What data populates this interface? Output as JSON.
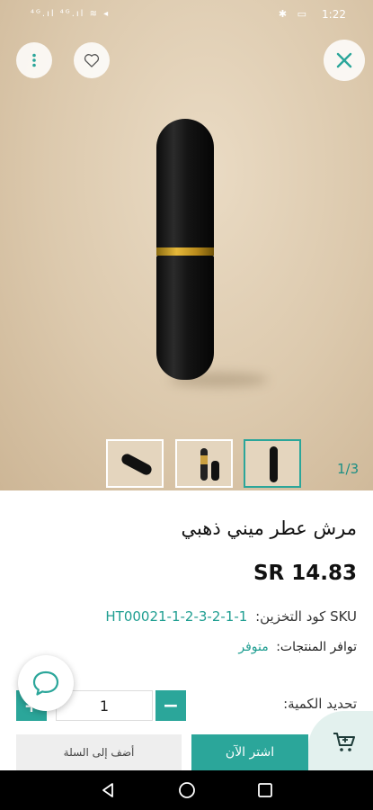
{
  "status_bar": {
    "left_icons": "⁴ᴳ.ıl ⁴ᴳ.ıl ≋ ◂",
    "right_icons": "✱ ▭",
    "time": "1:22"
  },
  "product": {
    "title": "مرش عطر ميني ذهبي",
    "price": "SR 14.83",
    "sku_label": "SKU كود التخزين:",
    "sku_value": "HT00021-1-2-3-2-1-1",
    "availability_label": "توافر المنتجات:",
    "availability_value": "متوفر",
    "image_counter": "1/3"
  },
  "quantity": {
    "label": "تحديد الكمية:",
    "value": "1"
  },
  "actions": {
    "buy_now": "اشتر الآن",
    "add_to_cart": "أضف إلى السلة"
  },
  "colors": {
    "accent": "#2ba69a",
    "hero_bg": "#dcc9ad"
  },
  "icons": [
    "more-vertical-icon",
    "heart-icon",
    "close-icon",
    "chat-icon",
    "cart-icon",
    "back-icon",
    "home-icon",
    "recent-apps-icon"
  ]
}
